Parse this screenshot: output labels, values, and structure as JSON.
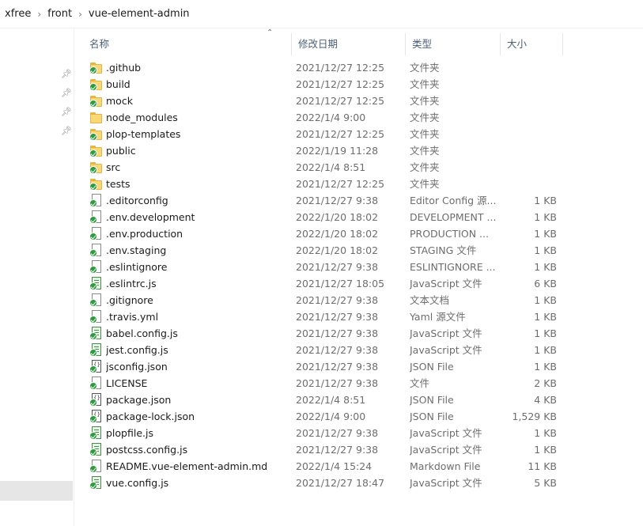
{
  "breadcrumb": [
    {
      "label": "xfree"
    },
    {
      "label": "front"
    },
    {
      "label": "vue-element-admin"
    }
  ],
  "columns": {
    "name": "名称",
    "date": "修改日期",
    "type": "类型",
    "size": "大小"
  },
  "files": [
    {
      "name": ".github",
      "date": "2021/12/27 12:25",
      "type": "文件夹",
      "size": "",
      "icon": "folder",
      "synced": true
    },
    {
      "name": "build",
      "date": "2021/12/27 12:25",
      "type": "文件夹",
      "size": "",
      "icon": "folder",
      "synced": true
    },
    {
      "name": "mock",
      "date": "2021/12/27 12:25",
      "type": "文件夹",
      "size": "",
      "icon": "folder",
      "synced": true
    },
    {
      "name": "node_modules",
      "date": "2022/1/4 9:00",
      "type": "文件夹",
      "size": "",
      "icon": "folder",
      "synced": false
    },
    {
      "name": "plop-templates",
      "date": "2021/12/27 12:25",
      "type": "文件夹",
      "size": "",
      "icon": "folder",
      "synced": true
    },
    {
      "name": "public",
      "date": "2022/1/19 11:28",
      "type": "文件夹",
      "size": "",
      "icon": "folder",
      "synced": true
    },
    {
      "name": "src",
      "date": "2022/1/4 8:51",
      "type": "文件夹",
      "size": "",
      "icon": "folder",
      "synced": true
    },
    {
      "name": "tests",
      "date": "2021/12/27 12:25",
      "type": "文件夹",
      "size": "",
      "icon": "folder",
      "synced": true
    },
    {
      "name": ".editorconfig",
      "date": "2021/12/27 9:38",
      "type": "Editor Config 源...",
      "size": "1 KB",
      "icon": "file",
      "synced": true
    },
    {
      "name": ".env.development",
      "date": "2022/1/20 18:02",
      "type": "DEVELOPMENT ...",
      "size": "1 KB",
      "icon": "file",
      "synced": true
    },
    {
      "name": ".env.production",
      "date": "2022/1/20 18:02",
      "type": "PRODUCTION ...",
      "size": "1 KB",
      "icon": "file",
      "synced": true
    },
    {
      "name": ".env.staging",
      "date": "2022/1/20 18:02",
      "type": "STAGING 文件",
      "size": "1 KB",
      "icon": "file",
      "synced": true
    },
    {
      "name": ".eslintignore",
      "date": "2021/12/27 9:38",
      "type": "ESLINTIGNORE ...",
      "size": "1 KB",
      "icon": "file",
      "synced": true
    },
    {
      "name": ".eslintrc.js",
      "date": "2021/12/27 18:05",
      "type": "JavaScript 文件",
      "size": "6 KB",
      "icon": "js",
      "synced": true
    },
    {
      "name": ".gitignore",
      "date": "2021/12/27 9:38",
      "type": "文本文档",
      "size": "1 KB",
      "icon": "file",
      "synced": true
    },
    {
      "name": ".travis.yml",
      "date": "2021/12/27 9:38",
      "type": "Yaml 源文件",
      "size": "1 KB",
      "icon": "file",
      "synced": true
    },
    {
      "name": "babel.config.js",
      "date": "2021/12/27 9:38",
      "type": "JavaScript 文件",
      "size": "1 KB",
      "icon": "js",
      "synced": true
    },
    {
      "name": "jest.config.js",
      "date": "2021/12/27 9:38",
      "type": "JavaScript 文件",
      "size": "1 KB",
      "icon": "js",
      "synced": true
    },
    {
      "name": "jsconfig.json",
      "date": "2021/12/27 9:38",
      "type": "JSON File",
      "size": "1 KB",
      "icon": "json",
      "synced": true
    },
    {
      "name": "LICENSE",
      "date": "2021/12/27 9:38",
      "type": "文件",
      "size": "2 KB",
      "icon": "file",
      "synced": true
    },
    {
      "name": "package.json",
      "date": "2022/1/4 8:51",
      "type": "JSON File",
      "size": "4 KB",
      "icon": "json",
      "synced": true
    },
    {
      "name": "package-lock.json",
      "date": "2022/1/4 9:00",
      "type": "JSON File",
      "size": "1,529 KB",
      "icon": "json",
      "synced": true
    },
    {
      "name": "plopfile.js",
      "date": "2021/12/27 9:38",
      "type": "JavaScript 文件",
      "size": "1 KB",
      "icon": "js",
      "synced": true
    },
    {
      "name": "postcss.config.js",
      "date": "2021/12/27 9:38",
      "type": "JavaScript 文件",
      "size": "1 KB",
      "icon": "js",
      "synced": true
    },
    {
      "name": "README.vue-element-admin.md",
      "date": "2022/1/4 15:24",
      "type": "Markdown File",
      "size": "11 KB",
      "icon": "file",
      "synced": true
    },
    {
      "name": "vue.config.js",
      "date": "2021/12/27 18:47",
      "type": "JavaScript 文件",
      "size": "5 KB",
      "icon": "js",
      "synced": true
    }
  ]
}
